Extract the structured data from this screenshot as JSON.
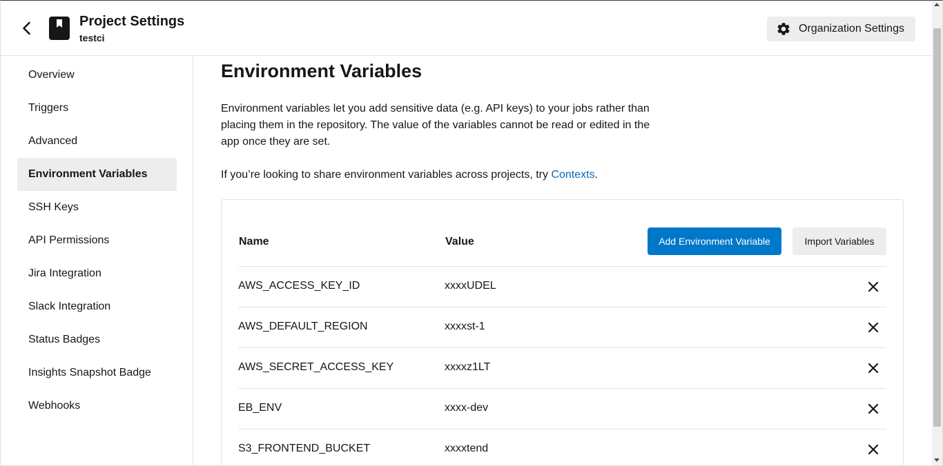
{
  "header": {
    "title": "Project Settings",
    "subtitle": "testci",
    "org_settings_label": "Organization Settings",
    "back_icon": "chevron-left-icon",
    "project_icon": "bookmark-icon",
    "gear_icon": "gear-icon"
  },
  "sidebar": {
    "items": [
      {
        "label": "Overview",
        "active": false
      },
      {
        "label": "Triggers",
        "active": false
      },
      {
        "label": "Advanced",
        "active": false
      },
      {
        "label": "Environment Variables",
        "active": true
      },
      {
        "label": "SSH Keys",
        "active": false
      },
      {
        "label": "API Permissions",
        "active": false
      },
      {
        "label": "Jira Integration",
        "active": false
      },
      {
        "label": "Slack Integration",
        "active": false
      },
      {
        "label": "Status Badges",
        "active": false
      },
      {
        "label": "Insights Snapshot Badge",
        "active": false
      },
      {
        "label": "Webhooks",
        "active": false
      }
    ]
  },
  "main": {
    "title": "Environment Variables",
    "description": "Environment variables let you add sensitive data (e.g. API keys) to your jobs rather than placing them in the repository. The value of the variables cannot be read or edited in the app once they are set.",
    "share_text": "If you’re looking to share environment variables across projects, try ",
    "share_link": "Contexts",
    "share_suffix": ".",
    "table": {
      "col_name": "Name",
      "col_value": "Value",
      "add_button": "Add Environment Variable",
      "import_button": "Import Variables",
      "rows": [
        {
          "name": "AWS_ACCESS_KEY_ID",
          "value": "xxxxUDEL"
        },
        {
          "name": "AWS_DEFAULT_REGION",
          "value": "xxxxst-1"
        },
        {
          "name": "AWS_SECRET_ACCESS_KEY",
          "value": "xxxxz1LT"
        },
        {
          "name": "EB_ENV",
          "value": "xxxx-dev"
        },
        {
          "name": "S3_FRONTEND_BUCKET",
          "value": "xxxxtend"
        }
      ]
    }
  },
  "colors": {
    "accent": "#0078ca",
    "link": "#0b67b5",
    "active_bg": "#ededed"
  }
}
